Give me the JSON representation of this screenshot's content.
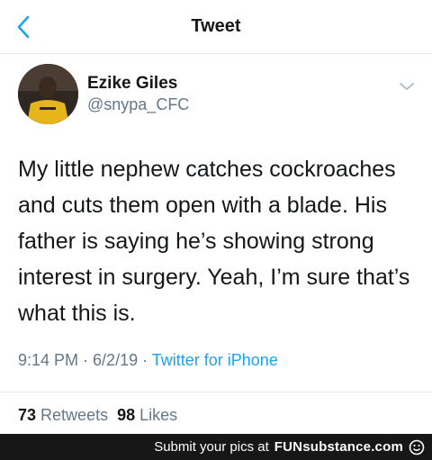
{
  "header": {
    "title": "Tweet",
    "back_icon": "chevron-left-icon",
    "accent_color": "#1da1f2"
  },
  "user": {
    "display_name": "Ezike Giles",
    "handle": "@snypa_CFC",
    "menu_icon": "chevron-down-icon"
  },
  "tweet": {
    "text": "My little nephew catches cockroaches and cuts them open with a blade. His father is saying he’s showing strong interest in surgery. Yeah, I’m sure that’s what this is.",
    "time": "9:14 PM",
    "separator": " · ",
    "date": "6/2/19",
    "source": "Twitter for iPhone"
  },
  "stats": {
    "retweets_count": "73",
    "retweets_label": "Retweets",
    "likes_count": "98",
    "likes_label": "Likes"
  },
  "footer": {
    "text": "Submit your pics at",
    "brand": "FUNsubstance.com"
  }
}
